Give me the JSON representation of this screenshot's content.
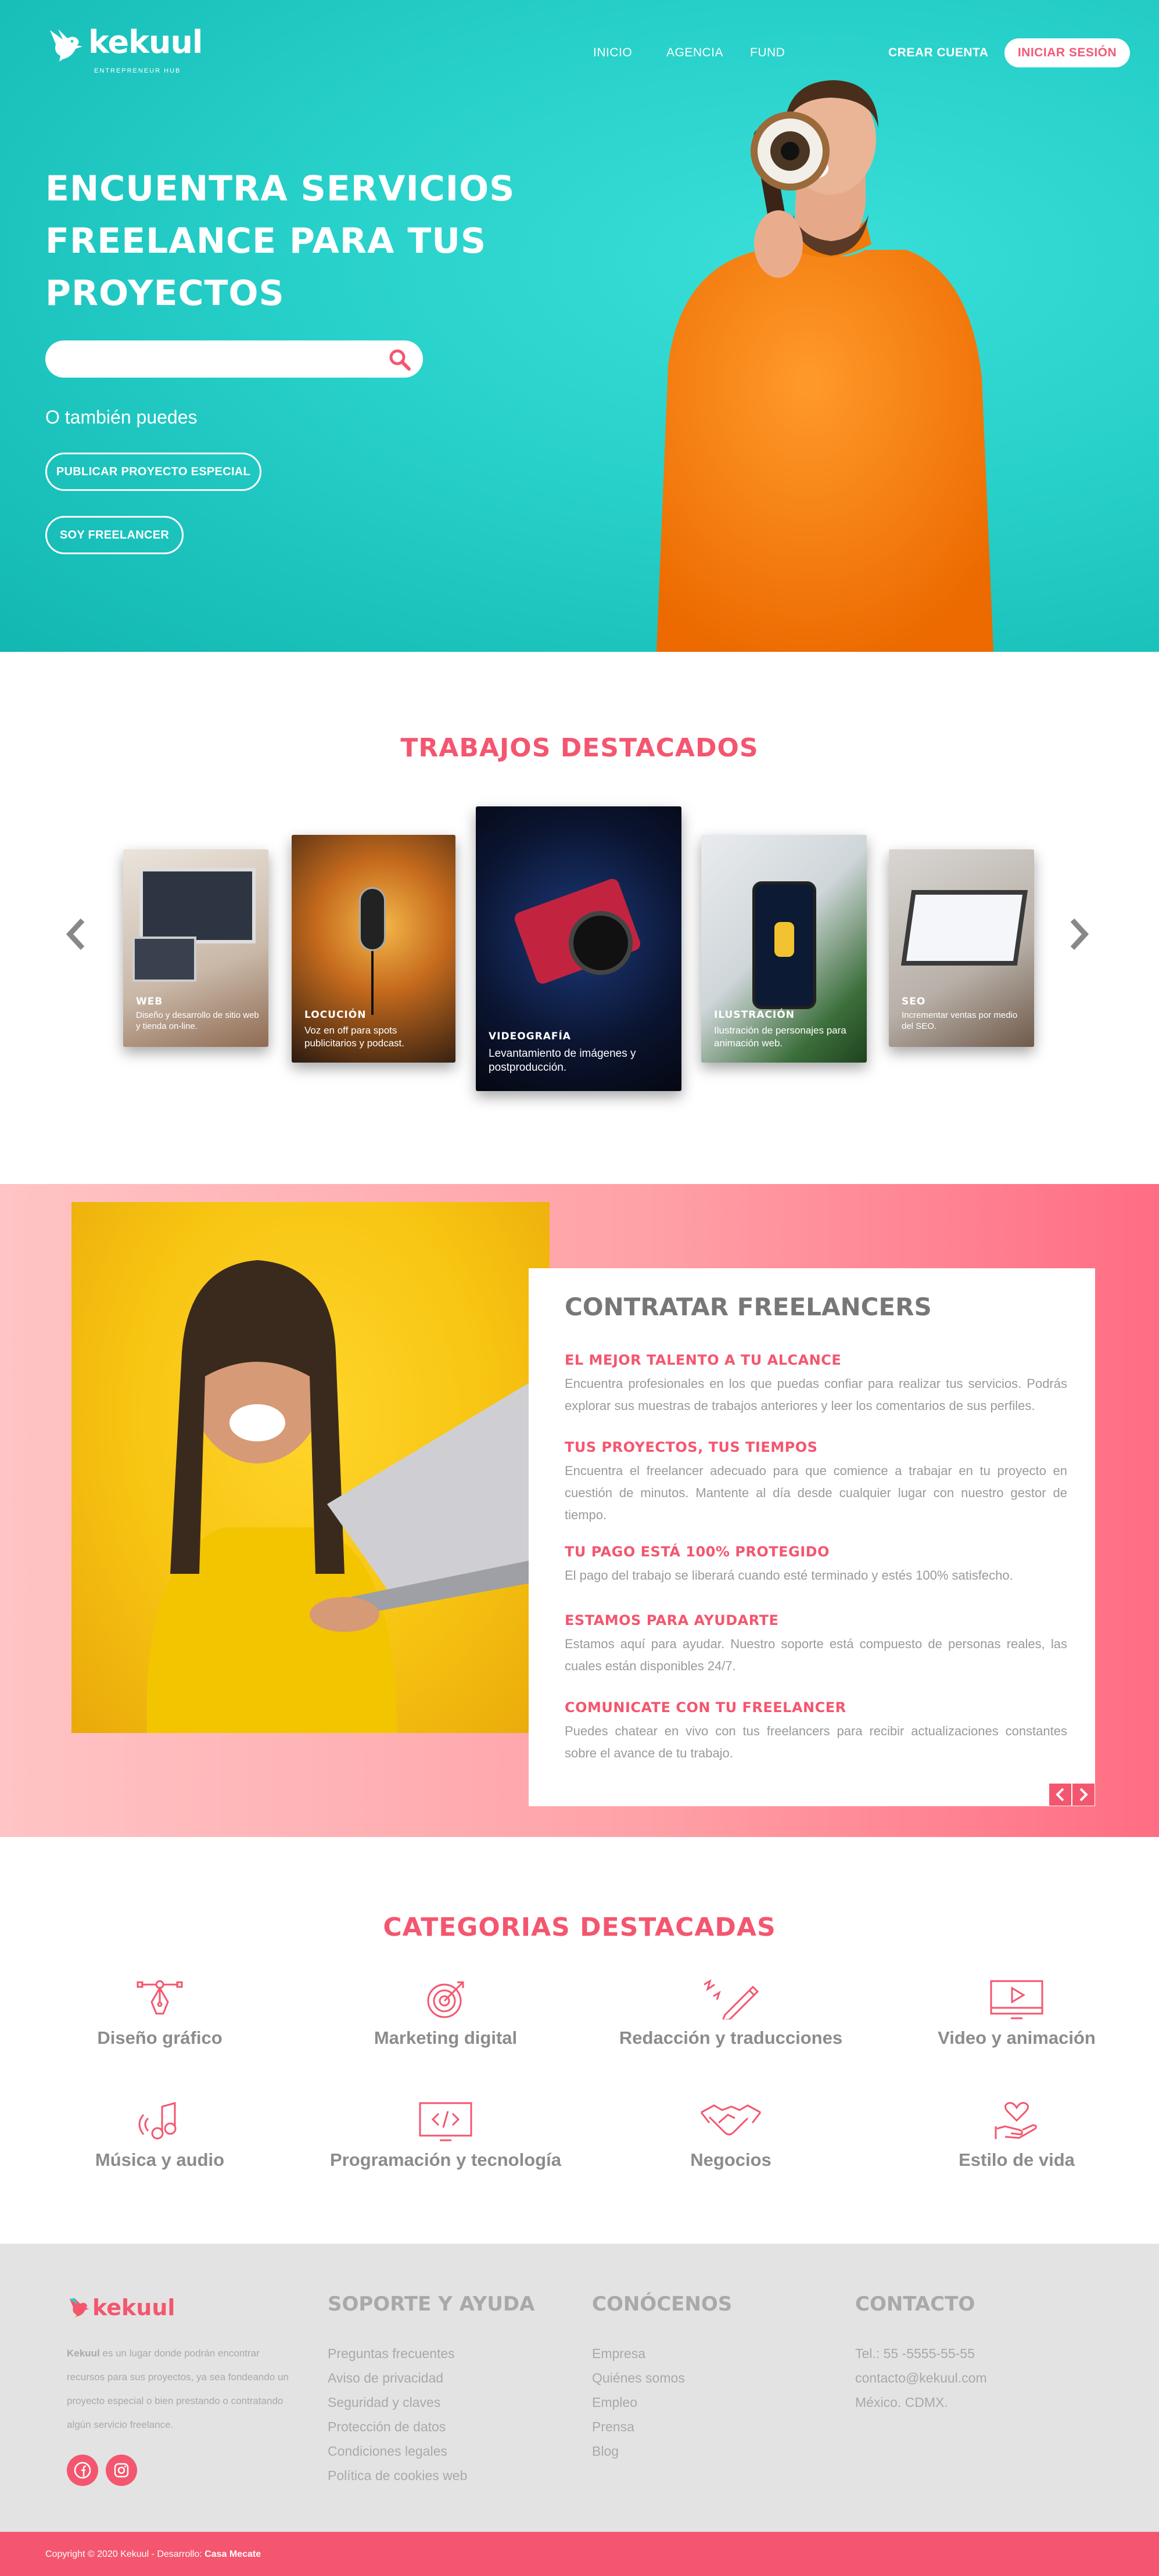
{
  "brand": {
    "name": "kekuul",
    "tagline": "ENTREPRENEUR HUB"
  },
  "nav": {
    "items": [
      "INICIO",
      "AGENCIA",
      "FUND"
    ],
    "create_account": "CREAR CUENTA",
    "login": "INICIAR SESIÓN"
  },
  "hero": {
    "title_lines": [
      "ENCUENTRA SERVICIOS",
      "FREELANCE PARA TUS",
      "PROYECTOS"
    ],
    "search_placeholder": "",
    "also_text": "O también puedes",
    "btn_publish": "PUBLICAR PROYECTO ESPECIAL",
    "btn_freelancer": "SOY FREELANCER"
  },
  "featured": {
    "title": "TRABAJOS DESTACADOS",
    "cards": [
      {
        "title": "WEB",
        "desc": "Diseño y desarrollo de sitio web y tienda on-line."
      },
      {
        "title": "LOCUCIÓN",
        "desc": "Voz en off para spots publicitarios y podcast."
      },
      {
        "title": "VIDEOGRAFÍA",
        "desc": "Levantamiento de imágenes y postproducción."
      },
      {
        "title": "ILUSTRACIÓN",
        "desc": "Ilustración de personajes para animación web."
      },
      {
        "title": "SEO",
        "desc": "Incrementar ventas por medio del SEO."
      }
    ]
  },
  "hire": {
    "title": "CONTRATAR FREELANCERS",
    "items": [
      {
        "heading": "EL MEJOR TALENTO A TU ALCANCE",
        "text": "Encuentra profesionales en los que puedas confiar para realizar tus servicios. Podrás explorar sus muestras de trabajos anteriores y leer los comentarios de sus perfiles."
      },
      {
        "heading": "TUS PROYECTOS, TUS TIEMPOS",
        "text": "Encuentra el freelancer adecuado para que comience a trabajar en tu proyecto en cuestión de minutos. Mantente al día desde cualquier lugar con nuestro gestor de tiempo."
      },
      {
        "heading": "TU PAGO ESTÁ 100% PROTEGIDO",
        "text": "El pago del trabajo se liberará cuando esté terminado y estés 100% satisfecho."
      },
      {
        "heading": "ESTAMOS PARA AYUDARTE",
        "text": "Estamos aquí para ayudar. Nuestro soporte está compuesto de personas reales, las cuales están disponibles 24/7."
      },
      {
        "heading": "COMUNICATE CON TU FREELANCER",
        "text": "Puedes chatear en vivo con tus freelancers para recibir actualizaciones constantes sobre el avance de tu trabajo."
      }
    ]
  },
  "categories": {
    "title": "CATEGORIAS DESTACADAS",
    "items": [
      {
        "label": "Diseño gráfico",
        "icon": "pen-tool-icon"
      },
      {
        "label": "Marketing digital",
        "icon": "target-icon"
      },
      {
        "label": "Redacción y traducciones",
        "icon": "pencil-icon"
      },
      {
        "label": "Video y animación",
        "icon": "play-screen-icon"
      },
      {
        "label": "Música y audio",
        "icon": "music-icon"
      },
      {
        "label": "Programación y tecnología",
        "icon": "code-icon"
      },
      {
        "label": "Negocios",
        "icon": "handshake-icon"
      },
      {
        "label": "Estilo de vida",
        "icon": "heart-hand-icon"
      }
    ]
  },
  "footer": {
    "brand_bold": "Kekuul",
    "description": "es un lugar donde podrán encontrar recursos para sus proyectos, ya sea fondeando un proyecto especial o bien prestando o contratando algún servicio freelance.",
    "support": {
      "title": "SOPORTE Y AYUDA",
      "links": [
        "Preguntas frecuentes",
        "Aviso de privacidad",
        "Seguridad y claves",
        "Protección de datos",
        "Condiciones legales",
        "Política de cookies web"
      ]
    },
    "about": {
      "title": "CONÓCENOS",
      "links": [
        "Empresa",
        "Quiénes somos",
        "Empleo",
        "Prensa",
        "Blog"
      ]
    },
    "contact": {
      "title": "CONTACTO",
      "lines": [
        "Tel.: 55 -5555-55-55",
        "contacto@kekuul.com",
        "México. CDMX."
      ]
    },
    "copyright": "Copyright © 2020 Kekuul - Desarrollo:",
    "developer": "Casa Mecate"
  },
  "colors": {
    "accent": "#f4566f",
    "teal": "#27d0c9",
    "orange": "#ff7f0e",
    "gray": "#a9a9a9"
  }
}
